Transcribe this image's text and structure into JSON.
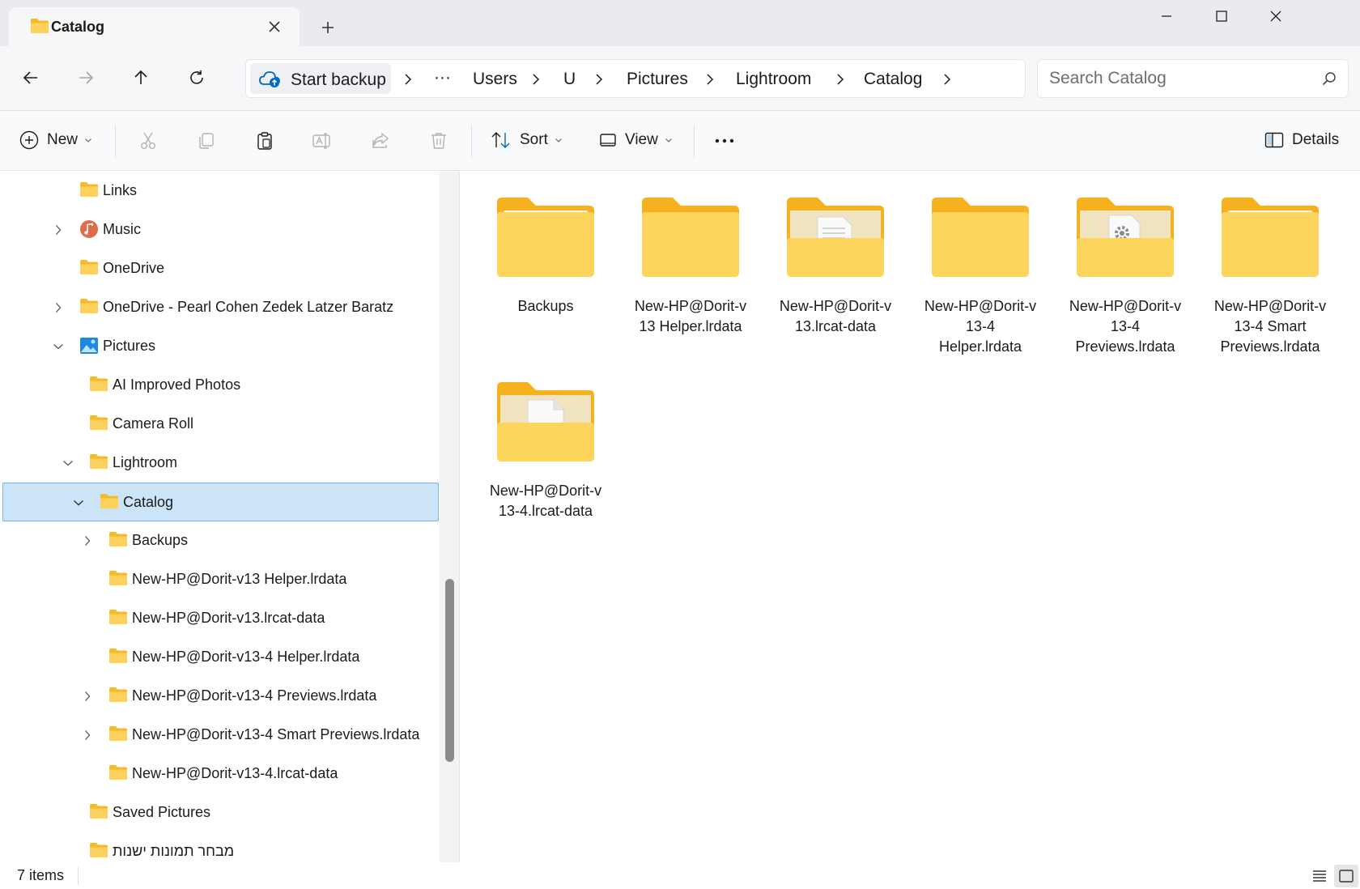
{
  "window": {
    "tab_title": "Catalog",
    "new_tab_glyph": "+"
  },
  "address": {
    "backup_label": "Start backup",
    "ellipsis": "···",
    "crumbs": [
      "Users",
      "U",
      "Pictures",
      "Lightroom",
      "Catalog"
    ]
  },
  "search": {
    "placeholder": "Search Catalog",
    "value": ""
  },
  "toolbar": {
    "new_label": "New",
    "sort_label": "Sort",
    "view_label": "View",
    "details_label": "Details",
    "more_glyph": "•••"
  },
  "nav": {
    "links": "Links",
    "music": "Music",
    "onedrive": "OneDrive",
    "onedrive_org": "OneDrive - Pearl Cohen Zedek Latzer Baratz",
    "pictures": "Pictures",
    "ai_improved": "AI Improved Photos",
    "camera_roll": "Camera Roll",
    "lightroom": "Lightroom",
    "catalog": "Catalog",
    "backups": "Backups",
    "helper_v13": "New-HP@Dorit-v13 Helper.lrdata",
    "lrcat_v13": "New-HP@Dorit-v13.lrcat-data",
    "helper_v13_4": "New-HP@Dorit-v13-4 Helper.lrdata",
    "previews_v13_4": "New-HP@Dorit-v13-4 Previews.lrdata",
    "smart_previews_v13_4": "New-HP@Dorit-v13-4 Smart Previews.lrdata",
    "lrcat_v13_4": "New-HP@Dorit-v13-4.lrcat-data",
    "saved_pictures": "Saved Pictures",
    "hebrew_folder": "מבחר תמונות ישנות"
  },
  "files": [
    {
      "line1": "Backups",
      "line2": "",
      "line3": "",
      "icon": "folder-icon"
    },
    {
      "line1": "New-HP@Dorit-v",
      "line2": "13 Helper.lrdata",
      "line3": "",
      "icon": "folder-icon"
    },
    {
      "line1": "New-HP@Dorit-v",
      "line2": "13.lrcat-data",
      "line3": "",
      "icon": "folder-with-document-icon"
    },
    {
      "line1": "New-HP@Dorit-v",
      "line2": "13-4",
      "line3": "Helper.lrdata",
      "icon": "folder-icon"
    },
    {
      "line1": "New-HP@Dorit-v",
      "line2": "13-4",
      "line3": "Previews.lrdata",
      "icon": "folder-with-settings-file-icon"
    },
    {
      "line1": "New-HP@Dorit-v",
      "line2": "13-4 Smart",
      "line3": "Previews.lrdata",
      "icon": "folder-icon"
    },
    {
      "line1": "New-HP@Dorit-v",
      "line2": "13-4.lrcat-data",
      "line3": "",
      "icon": "folder-with-document-icon"
    }
  ],
  "status": {
    "item_count": "7 items"
  },
  "colors": {
    "selection_bg": "#cce4f7",
    "selection_border": "#7ab3e6",
    "folder_yellow": "#f8c53d",
    "accent_blue": "#0067c0"
  }
}
